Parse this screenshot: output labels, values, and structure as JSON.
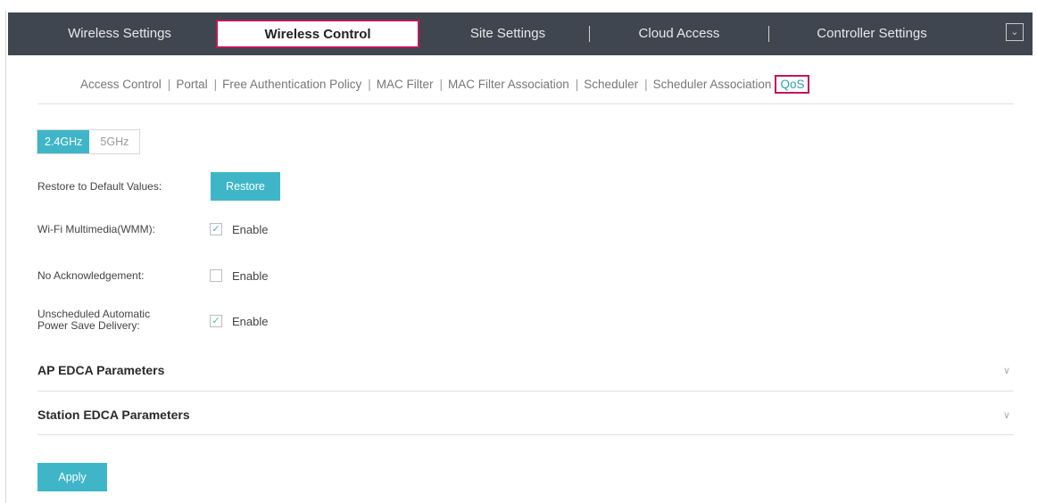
{
  "top_nav": {
    "tabs": [
      {
        "label": "Wireless Settings",
        "active": false
      },
      {
        "label": "Wireless Control",
        "active": true
      },
      {
        "label": "Site Settings",
        "active": false
      },
      {
        "label": "Cloud Access",
        "active": false
      },
      {
        "label": "Controller Settings",
        "active": false
      }
    ],
    "menu_icon": "chevron-down-icon"
  },
  "sub_nav": {
    "items": [
      {
        "label": "Access Control",
        "active": false
      },
      {
        "label": "Portal",
        "active": false
      },
      {
        "label": "Free Authentication Policy",
        "active": false
      },
      {
        "label": "MAC Filter",
        "active": false
      },
      {
        "label": "MAC Filter Association",
        "active": false
      },
      {
        "label": "Scheduler",
        "active": false
      },
      {
        "label": "Scheduler Association",
        "active": false
      },
      {
        "label": "QoS",
        "active": true
      }
    ],
    "separator": "|"
  },
  "band": {
    "options": [
      "2.4GHz",
      "5GHz"
    ],
    "selected": "2.4GHz"
  },
  "restore": {
    "label": "Restore to Default Values:",
    "button_label": "Restore"
  },
  "settings": [
    {
      "label": "Wi-Fi Multimedia(WMM):",
      "checkbox_label": "Enable",
      "checked": true
    },
    {
      "label": "No Acknowledgement:",
      "checkbox_label": "Enable",
      "checked": false
    },
    {
      "label_line1": "Unscheduled Automatic",
      "label_line2": "Power Save Delivery:",
      "checkbox_label": "Enable",
      "checked": true
    }
  ],
  "sections": [
    {
      "title": "AP EDCA Parameters",
      "icon": "double-chevron-down-icon"
    },
    {
      "title": "Station EDCA Parameters",
      "icon": "double-chevron-down-icon"
    }
  ],
  "apply_label": "Apply",
  "colors": {
    "accent": "#3fb6c8",
    "nav_bg": "#3f4650",
    "highlight": "#c0175d"
  }
}
